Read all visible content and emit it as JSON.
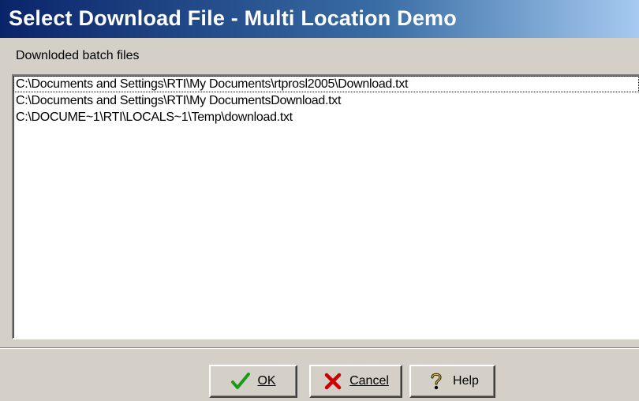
{
  "window": {
    "title": "Select Download File - Multi Location Demo"
  },
  "group": {
    "label": "Downloded batch files"
  },
  "files": [
    "C:\\Documents and Settings\\RTI\\My Documents\\rtprosl2005\\Download.txt",
    "C:\\Documents and Settings\\RTI\\My DocumentsDownload.txt",
    "C:\\DOCUME~1\\RTI\\LOCALS~1\\Temp\\download.txt"
  ],
  "buttons": {
    "ok": {
      "label": "OK",
      "icon": "checkmark-icon"
    },
    "cancel": {
      "label": "Cancel",
      "icon": "x-icon"
    },
    "help": {
      "label": "Help",
      "icon": "question-icon"
    }
  },
  "colors": {
    "title_start": "#0a246a",
    "title_end": "#a6caf0",
    "ok_green": "#1a9a1a",
    "cancel_red": "#cc0000"
  }
}
